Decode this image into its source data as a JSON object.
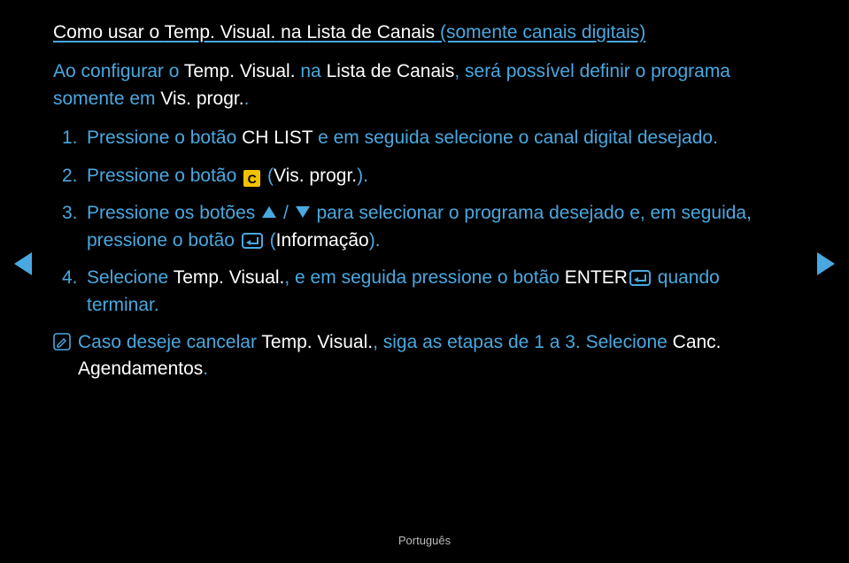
{
  "title": {
    "part1": "Como usar o ",
    "part2": "Temp. Visual.",
    "part3": " na ",
    "part4": "Lista de Canais",
    "part5": "  (somente canais digitais)"
  },
  "intro": {
    "t1": "Ao configurar o ",
    "t2": "Temp. Visual.",
    "t3": " na ",
    "t4": "Lista de Canais",
    "t5": ", será possível definir o programa somente em ",
    "t6": "Vis. progr."
  },
  "items": [
    {
      "num": "1.",
      "a": "Pressione o botão ",
      "b": "CH LIST",
      "c": " e em seguida selecione o canal digital desejado."
    },
    {
      "num": "2.",
      "a": "Pressione o botão ",
      "icon_letter": "C",
      "c": " (",
      "d": "Vis. progr.",
      "e": ")."
    },
    {
      "num": "3.",
      "a": "Pressione os botões ",
      "slash": " / ",
      "c": " para selecionar o programa desejado e, em seguida, pressione o botão ",
      "e": " (",
      "f": "Informação",
      "g": ")."
    },
    {
      "num": "4.",
      "a": "Selecione ",
      "b": "Temp. Visual.",
      "c": ", e em seguida pressione o botão ",
      "d": "ENTER",
      "e": " quando terminar."
    }
  ],
  "note": {
    "a": "Caso deseje cancelar ",
    "b": "Temp. Visual.",
    "c": ", siga as etapas de 1 a 3. Selecione ",
    "d": "Canc. Agendamentos",
    "e": "."
  },
  "footer": "Português"
}
